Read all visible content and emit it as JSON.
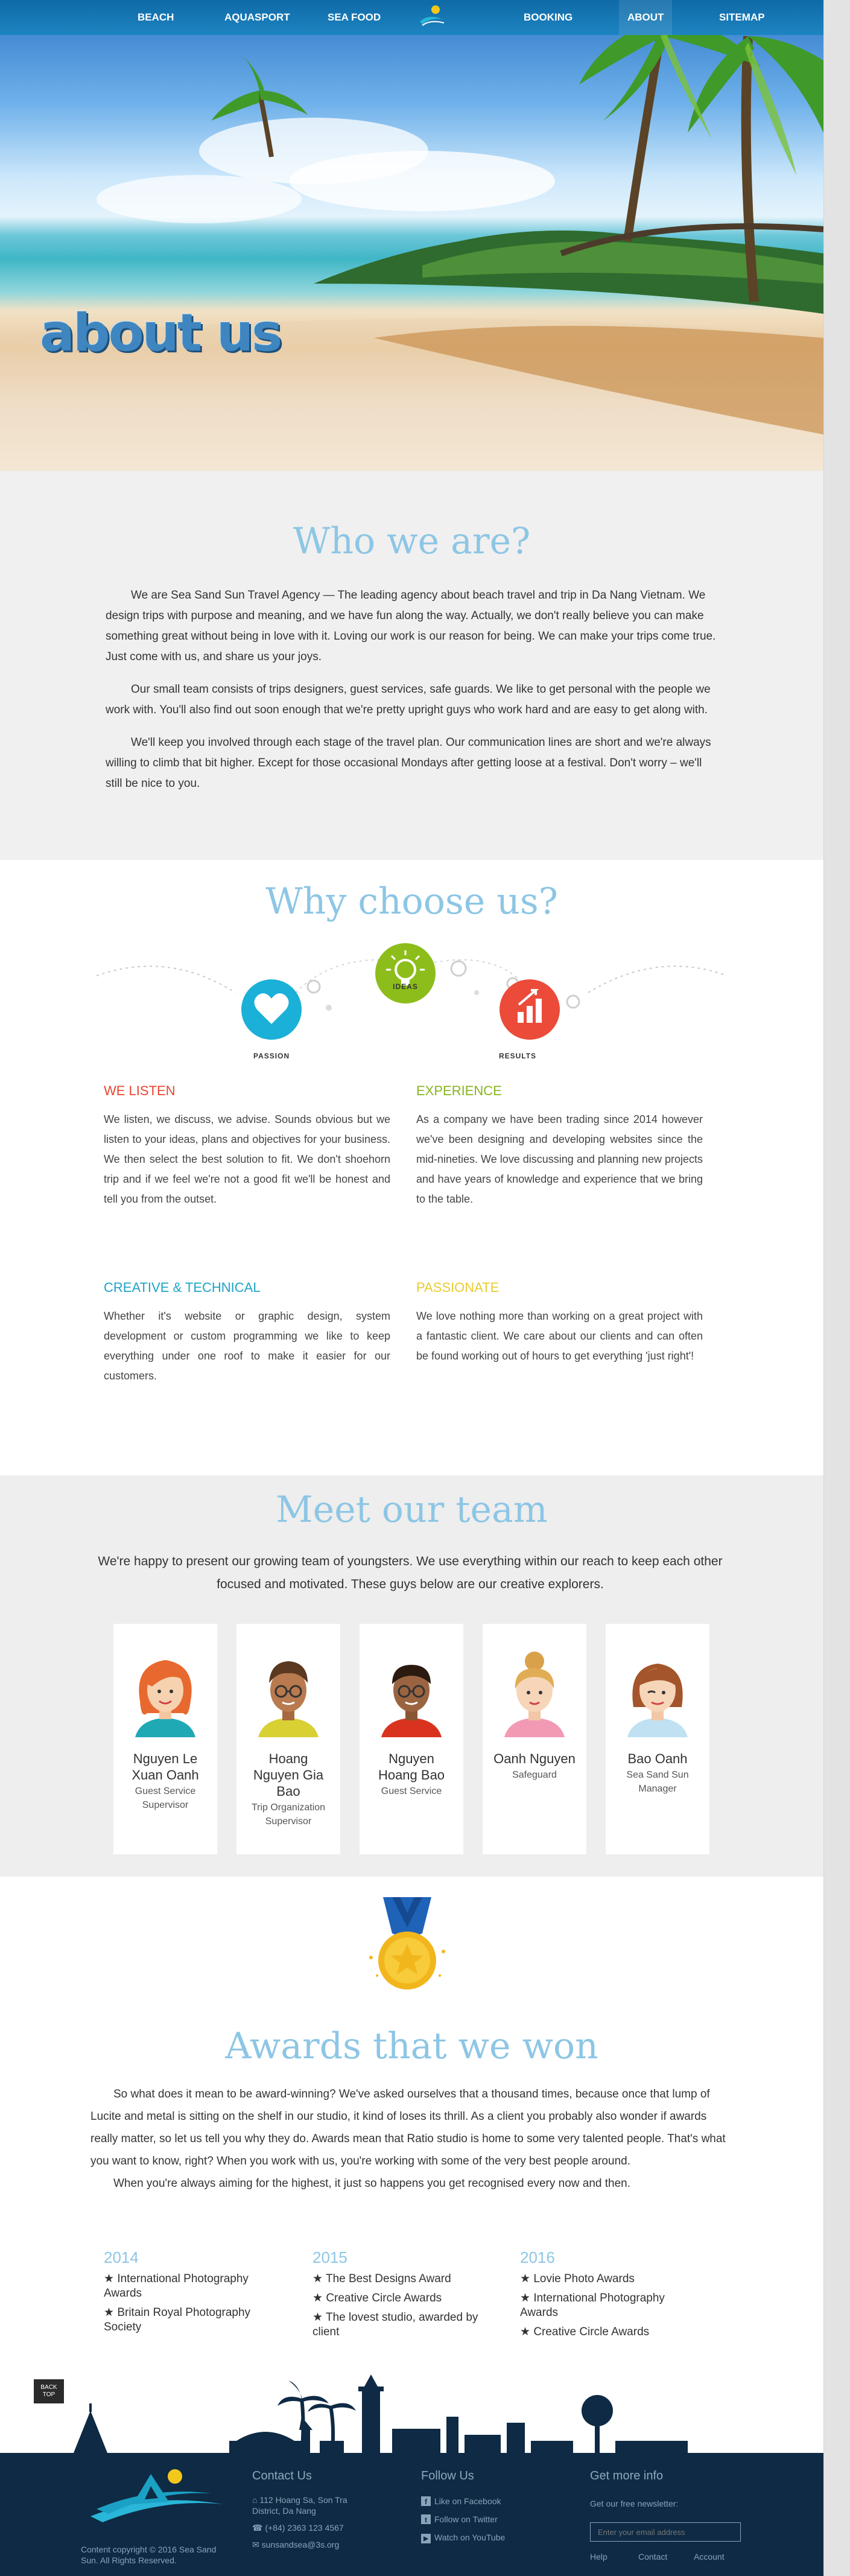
{
  "nav": {
    "items": [
      "BEACH",
      "AQUASPORT",
      "SEA FOOD",
      "BOOKING",
      "ABOUT",
      "SITEMAP"
    ],
    "active": "ABOUT"
  },
  "hero": {
    "title": "about us"
  },
  "who": {
    "title": "Who we are?",
    "paragraphs": [
      "We are Sea Sand Sun Travel Agency — The leading agency about beach travel and trip in Da Nang Vietnam. We design trips with purpose and meaning, and we have fun along the way. Actually, we don't really believe you can make something great without being in love with it. Loving our work is our reason for being. We can make your trips come true. Just come with us, and share us your joys.",
      "Our small team consists of trips designers, guest services, safe guards. We like to get personal with the people we work with. You'll also find out soon enough that we're pretty upright guys who work hard and are easy to get along with.",
      "We'll keep you involved through each stage of the travel plan. Our communication lines are short and we're always willing to climb that bit higher. Except for those occasional Mondays after getting loose at a festival. Don't worry – we'll still be nice to you."
    ]
  },
  "why": {
    "title": "Why choose us?",
    "icons": [
      {
        "label": "PASSION",
        "color": "#1ab0d8",
        "icon": "heart-icon"
      },
      {
        "label": "IDEAS",
        "color": "#8dbd1b",
        "icon": "lightbulb-icon"
      },
      {
        "label": "RESULTS",
        "color": "#ec4b3a",
        "icon": "chart-up-icon"
      }
    ],
    "blocks": [
      {
        "title": "WE LISTEN",
        "color": "#e84632",
        "text": "We listen, we discuss, we advise. Sounds obvious but we listen to your ideas, plans and objectives for your business. We then select the best solution to fit. We don't shoehorn trip and if we feel we're not a good fit we'll be honest and tell you from the outset."
      },
      {
        "title": "EXPERIENCE",
        "color": "#87b51d",
        "text": "As a company we have been trading since 2014 however we've been designing and developing websites since the mid-nineties. We love discussing and planning new projects and have years of knowledge and experience that we bring to the table."
      },
      {
        "title": "CREATIVE & TECHNICAL",
        "color": "#1da4c7",
        "text": "Whether it's website or graphic design, system development or custom programming we like to keep everything under one roof to make it easier for our customers."
      },
      {
        "title": "PASSIONATE",
        "color": "#e8cc32",
        "text": "We love nothing more than working on a great project with a fantastic client. We care about our clients and can often be found working out of hours to get everything 'just right'!"
      }
    ]
  },
  "team": {
    "title": "Meet our team",
    "intro": "We're happy to present our growing team of youngsters. We use everything within our reach to keep each other focused and motivated. These guys below are our creative explorers.",
    "members": [
      {
        "name": "Nguyen Le Xuan Oanh",
        "role": "Guest Service Supervisor"
      },
      {
        "name": "Hoang Nguyen Gia Bao",
        "role": "Trip Organization Supervisor"
      },
      {
        "name": "Nguyen Hoang Bao",
        "role": "Guest Service"
      },
      {
        "name": "Oanh Nguyen",
        "role": "Safeguard"
      },
      {
        "name": "Bao Oanh",
        "role": "Sea Sand Sun Manager"
      }
    ]
  },
  "awards": {
    "title": "Awards that we won",
    "paragraphs": [
      "So what does it mean to be award-winning? We've asked ourselves that a thousand times, because once that lump of Lucite and metal is sitting on the shelf in our studio, it kind of loses its thrill. As a client you probably also wonder if awards really matter, so let us tell you why they do. Awards mean that Ratio studio is home to some very talented people. That's what you want to know, right? When you work with us, you're working with some of the very best people around.",
      "When you're always aiming for the highest, it just so happens you get recognised every now and then."
    ],
    "years": [
      {
        "year": "2014",
        "items": [
          "International Photography Awards",
          "Britain Royal Photography Society"
        ]
      },
      {
        "year": "2015",
        "items": [
          "The Best Designs Award",
          "Creative Circle Awards",
          "The lovest studio, awarded by client"
        ]
      },
      {
        "year": "2016",
        "items": [
          "Lovie Photo Awards",
          "International Photography Awards",
          "Creative Circle Awards"
        ]
      }
    ]
  },
  "back_top": {
    "line1": "BACK",
    "line2": "TOP"
  },
  "footer": {
    "copyright": "Content copyright © 2016 Sea Sand Sun. All Rights Reserved.",
    "contact": {
      "title": "Contact Us",
      "address": "112 Hoang Sa, Son Tra District, Da Nang",
      "phone": "(+84) 2363 123 4567",
      "email": "sunsandsea@3s.org"
    },
    "follow": {
      "title": "Follow Us",
      "facebook": "Like on Facebook",
      "twitter": "Follow on Twitter",
      "youtube": "Watch on YouTube"
    },
    "more": {
      "title": "Get more info",
      "newsletter": "Get our free newsletter:",
      "placeholder": "Enter your email address",
      "links": [
        "Help",
        "Contact",
        "Account"
      ]
    }
  }
}
